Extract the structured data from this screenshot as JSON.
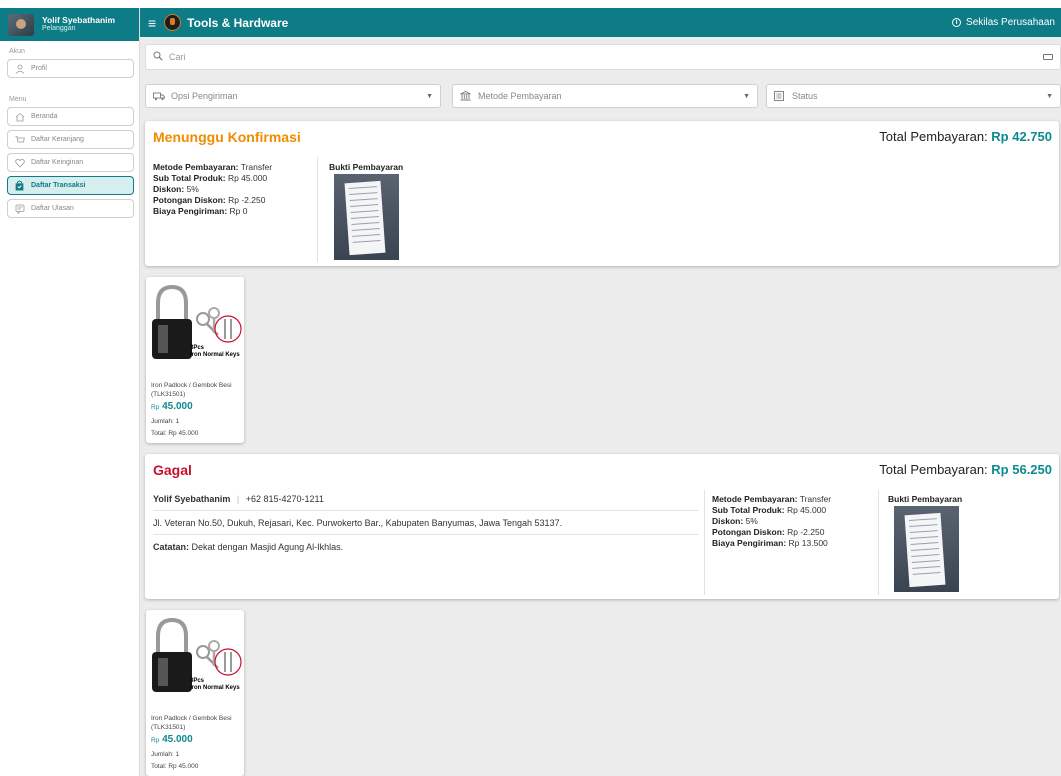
{
  "user": {
    "name": "Yolif Syebathanim",
    "role": "Pelanggan"
  },
  "sidebar": {
    "section_account": "Akun",
    "profile_label": "Profil",
    "section_menu": "Menu",
    "items": [
      {
        "label": "Beranda",
        "icon": "home-icon"
      },
      {
        "label": "Daftar Keranjang",
        "icon": "cart-icon"
      },
      {
        "label": "Daftar Keinginan",
        "icon": "heart-icon"
      },
      {
        "label": "Daftar Transaksi",
        "icon": "bag-icon",
        "active": true
      },
      {
        "label": "Daftar Ulasan",
        "icon": "review-icon"
      }
    ]
  },
  "appbar": {
    "title": "Tools & Hardware",
    "about_label": "Sekilas Perusahaan"
  },
  "search": {
    "placeholder": "Cari"
  },
  "filters": {
    "shipping": "Opsi Pengiriman",
    "payment": "Metode Pembayaran",
    "status": "Status"
  },
  "transactions": [
    {
      "status": "Menunggu Konfirmasi",
      "status_color": "#f08c00",
      "total_label": "Total Pembayaran:",
      "total_value": "Rp 42.750",
      "method_label": "Metode Pembayaran:",
      "method_value": "Transfer",
      "subtotal_label": "Sub Total Produk:",
      "subtotal_value": "Rp 45.000",
      "discount_label": "Diskon:",
      "discount_value": "5%",
      "cut_label": "Potongan Diskon:",
      "cut_value": "Rp -2.250",
      "ship_label": "Biaya Pengiriman:",
      "ship_value": "Rp 0",
      "proof_label": "Bukti Pembayaran",
      "product": {
        "name": "Iron Padlock / Gembok Besi (TLK31501)",
        "currency": "Rp",
        "price": "45.000",
        "qty": "Jumlah: 1",
        "total": "Total: Rp 45.000",
        "image_caption_1": "3Pcs",
        "image_caption_2": "Iron Normal Keys"
      }
    },
    {
      "status": "Gagal",
      "status_color": "#c8102e",
      "total_label": "Total Pembayaran:",
      "total_value": "Rp 56.250",
      "customer_name": "Yolif Syebathanim",
      "customer_phone": "+62 815-4270-1211",
      "address": "Jl. Veteran No.50, Dukuh, Rejasari, Kec. Purwokerto Bar., Kabupaten Banyumas, Jawa Tengah 53137.",
      "note_label": "Catatan:",
      "note_value": "Dekat dengan Masjid Agung Al-Ikhlas.",
      "method_label": "Metode Pembayaran:",
      "method_value": "Transfer",
      "subtotal_label": "Sub Total Produk:",
      "subtotal_value": "Rp 45.000",
      "discount_label": "Diskon:",
      "discount_value": "5%",
      "cut_label": "Potongan Diskon:",
      "cut_value": "Rp -2.250",
      "ship_label": "Biaya Pengiriman:",
      "ship_value": "Rp 13.500",
      "proof_label": "Bukti Pembayaran",
      "product": {
        "name": "Iron Padlock / Gembok Besi (TLK31501)",
        "currency": "Rp",
        "price": "45.000",
        "qty": "Jumlah: 1",
        "total": "Total: Rp 45.000",
        "image_caption_1": "3Pcs",
        "image_caption_2": "Iron Normal Keys"
      }
    }
  ],
  "colors": {
    "primary": "#0e7c86",
    "price": "#0e8a91"
  }
}
